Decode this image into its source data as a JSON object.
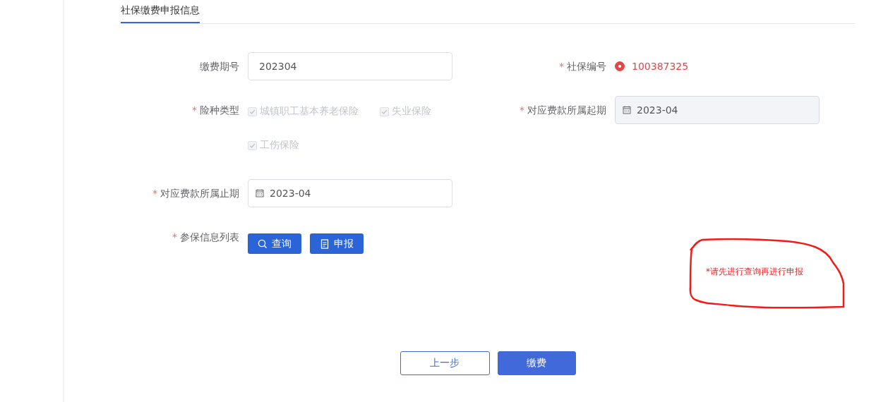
{
  "tabs": [
    {
      "label": "社保缴费申报信息",
      "selected": true
    }
  ],
  "rows": [
    [
      {
        "kind": "text",
        "label": "缴费期号",
        "value": "202304"
      },
      {
        "kind": "radio",
        "mark": "*",
        "label": "社保编号",
        "selected": true,
        "value": "100387325"
      }
    ],
    [
      {
        "kind": "checkboxes",
        "mark": "*",
        "label": "险种类型",
        "options": [
          {
            "label": "城镇职工基本养老保险",
            "checked": true,
            "disabled": true
          },
          {
            "label": "失业保险",
            "checked": true,
            "disabled": true
          },
          {
            "label": "工伤保险",
            "checked": true,
            "disabled": true
          }
        ]
      },
      {
        "kind": "date",
        "mark": "*",
        "label": "对应费款所属起期",
        "value": "2023-04",
        "disabled": true
      }
    ],
    [
      {
        "kind": "date",
        "mark": "*",
        "label": "对应费款所属止期",
        "value": "2023-04",
        "disabled": false
      }
    ],
    [
      {
        "kind": "buttons",
        "mark": "*",
        "label": "参保信息列表",
        "buttons": [
          {
            "kind": "query",
            "label": "查询"
          },
          {
            "kind": "report",
            "label": "申报"
          }
        ]
      }
    ]
  ],
  "annotation": {
    "text": "*请先进行查询再进行申报"
  },
  "footer": {
    "buttons": [
      {
        "label": "上一步",
        "primary": false
      },
      {
        "label": "缴费",
        "primary": true
      }
    ]
  }
}
